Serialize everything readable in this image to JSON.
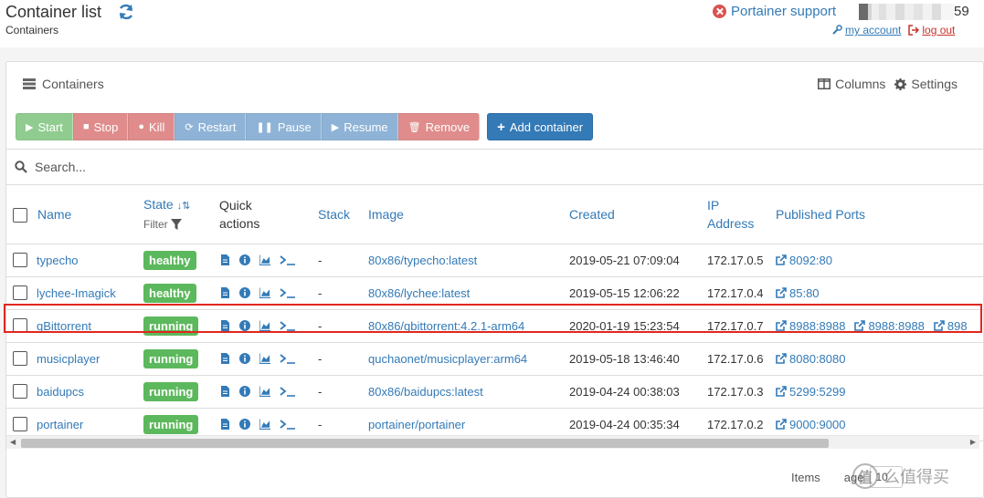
{
  "header": {
    "title": "Container list",
    "breadcrumb": "Containers",
    "support_label": "Portainer support",
    "username_suffix": "59",
    "my_account_label": "my account",
    "logout_label": "log out"
  },
  "panel": {
    "title": "Containers",
    "columns_label": "Columns",
    "settings_label": "Settings"
  },
  "toolbar": {
    "start": "Start",
    "stop": "Stop",
    "kill": "Kill",
    "restart": "Restart",
    "pause": "Pause",
    "resume": "Resume",
    "remove": "Remove",
    "add": "Add container"
  },
  "search": {
    "placeholder": "Search..."
  },
  "table": {
    "columns": {
      "name": "Name",
      "state": "State",
      "filter": "Filter",
      "quick_actions_1": "Quick",
      "quick_actions_2": "actions",
      "stack": "Stack",
      "image": "Image",
      "created": "Created",
      "ip_1": "IP",
      "ip_2": "Address",
      "ports": "Published Ports"
    },
    "rows": [
      {
        "name": "typecho",
        "state": "healthy",
        "stack": "-",
        "image": "80x86/typecho:latest",
        "created": "2019-05-21 07:09:04",
        "ip": "172.17.0.5",
        "ports": [
          "8092:80"
        ]
      },
      {
        "name": "lychee-Imagick",
        "state": "healthy",
        "stack": "-",
        "image": "80x86/lychee:latest",
        "created": "2019-05-15 12:06:22",
        "ip": "172.17.0.4",
        "ports": [
          "85:80"
        ]
      },
      {
        "name": "qBittorrent",
        "state": "running",
        "stack": "-",
        "image": "80x86/qbittorrent:4.2.1-arm64",
        "created": "2020-01-19 15:23:54",
        "ip": "172.17.0.7",
        "ports": [
          "8988:8988",
          "8988:8988",
          "898"
        ]
      },
      {
        "name": "musicplayer",
        "state": "running",
        "stack": "-",
        "image": "quchaonet/musicplayer:arm64",
        "created": "2019-05-18 13:46:40",
        "ip": "172.17.0.6",
        "ports": [
          "8080:8080"
        ]
      },
      {
        "name": "baidupcs",
        "state": "running",
        "stack": "-",
        "image": "80x86/baidupcs:latest",
        "created": "2019-04-24 00:38:03",
        "ip": "172.17.0.3",
        "ports": [
          "5299:5299"
        ]
      },
      {
        "name": "portainer",
        "state": "running",
        "stack": "-",
        "image": "portainer/portainer",
        "created": "2019-04-24 00:35:34",
        "ip": "172.17.0.2",
        "ports": [
          "9000:9000"
        ]
      }
    ]
  },
  "footer": {
    "items_label": "Items",
    "page_label": "age",
    "page_size": "10"
  },
  "watermark": {
    "logo": "值",
    "text": "么值得买"
  },
  "colors": {
    "accent": "#337ab7",
    "healthy": "#5cb85c",
    "danger": "#d9534f",
    "highlight": "#e0271f"
  }
}
